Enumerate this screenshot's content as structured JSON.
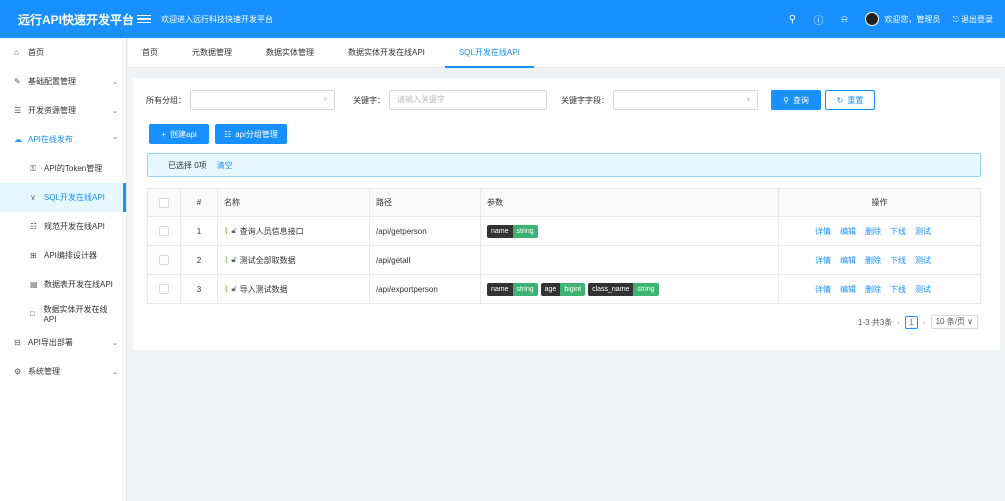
{
  "topbar": {
    "brand": "远行API快速开发平台",
    "welcome": "欢迎进入远行科技快速开发平台",
    "greeting": "欢迎您，管理员",
    "logout": "退出登录"
  },
  "sidebar": {
    "items": [
      {
        "label": "首页",
        "icon": "home-icon"
      },
      {
        "label": "基础配置管理",
        "icon": "tool-icon"
      },
      {
        "label": "开发资源管理",
        "icon": "list-icon"
      },
      {
        "label": "API在线发布",
        "icon": "cloud-icon"
      },
      {
        "label": "API的Token管理",
        "icon": "key-icon"
      },
      {
        "label": "SQL开发在线API",
        "icon": "branch-icon"
      },
      {
        "label": "规范开发在线API",
        "icon": "doc-icon"
      },
      {
        "label": "API编排设计器",
        "icon": "grid-icon"
      },
      {
        "label": "数据表开发在线API",
        "icon": "table-icon"
      },
      {
        "label": "数据实体开发在线API",
        "icon": "file-icon"
      },
      {
        "label": "API导出部署",
        "icon": "export-icon"
      },
      {
        "label": "系统管理",
        "icon": "gear-icon"
      }
    ]
  },
  "tabs": [
    "首页",
    "元数据管理",
    "数据实体管理",
    "数据实体开发在线API",
    "SQL开发在线API"
  ],
  "filters": {
    "group_label": "所有分组：",
    "keyword_label": "关键字：",
    "keyword_placeholder": "请输入关键字",
    "field_label": "关键字字段：",
    "search_btn": "查询",
    "reset_btn": "重置"
  },
  "actions": {
    "create": "创建api",
    "group_manage": "api分组管理"
  },
  "alert": {
    "selected": "已选择 0项",
    "clear": "清空"
  },
  "table": {
    "headers": [
      "#",
      "名称",
      "路径",
      "参数",
      "操作"
    ],
    "rows": [
      {
        "no": "1",
        "name": "查询人员信息接口",
        "path": "/api/getperson",
        "params": [
          {
            "k": "name",
            "v": "string"
          }
        ]
      },
      {
        "no": "2",
        "name": "测试全部取数据",
        "path": "/api/getall",
        "params": []
      },
      {
        "no": "3",
        "name": "导入测试数据",
        "path": "/api/exportperson",
        "params": [
          {
            "k": "name",
            "v": "string"
          },
          {
            "k": "age",
            "v": "bigint"
          },
          {
            "k": "class_name",
            "v": "string"
          }
        ]
      }
    ],
    "ops": [
      "详情",
      "编辑",
      "删除",
      "下线",
      "测试"
    ]
  },
  "pagination": {
    "total": "1-3 共3条",
    "current": "1",
    "size": "10 条/页"
  }
}
